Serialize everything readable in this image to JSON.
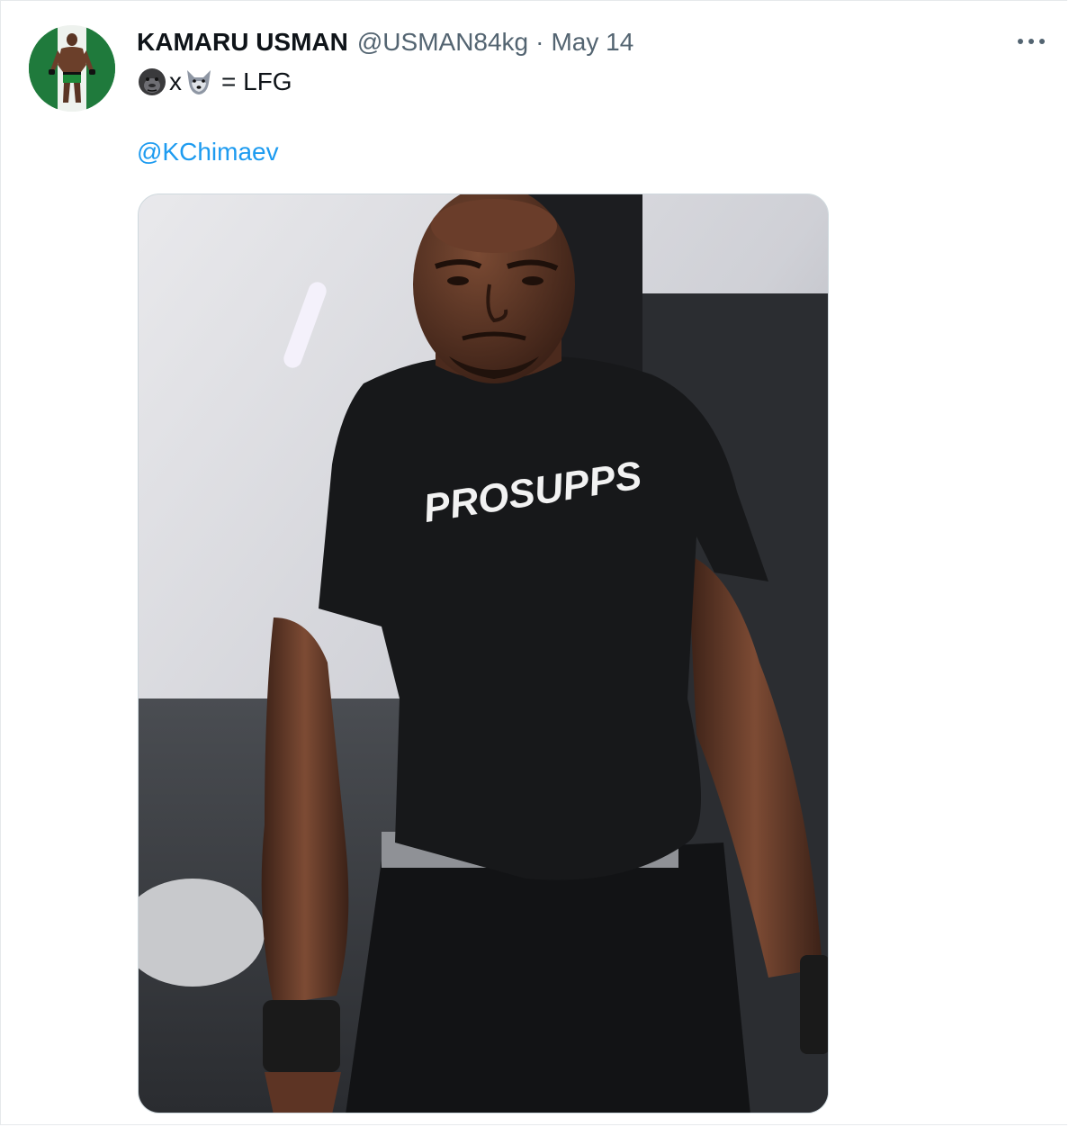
{
  "tweet": {
    "author": {
      "display_name": "KAMARU USMAN",
      "handle": "@USMAN84kg",
      "avatar_icon": "avatar-photo"
    },
    "separator": "·",
    "date": "May 14",
    "text": {
      "emoji_1": "gorilla-emoji",
      "connector": "x",
      "emoji_2": "wolf-emoji",
      "suffix": "= LFG"
    },
    "mention": "@KChimaev",
    "media": {
      "shirt_text": "PROSUPPS"
    },
    "more_icon": "more-horizontal-icon"
  },
  "colors": {
    "text_primary": "#0f1419",
    "text_secondary": "#536471",
    "link": "#1d9bf0",
    "border": "#cfd9de"
  }
}
